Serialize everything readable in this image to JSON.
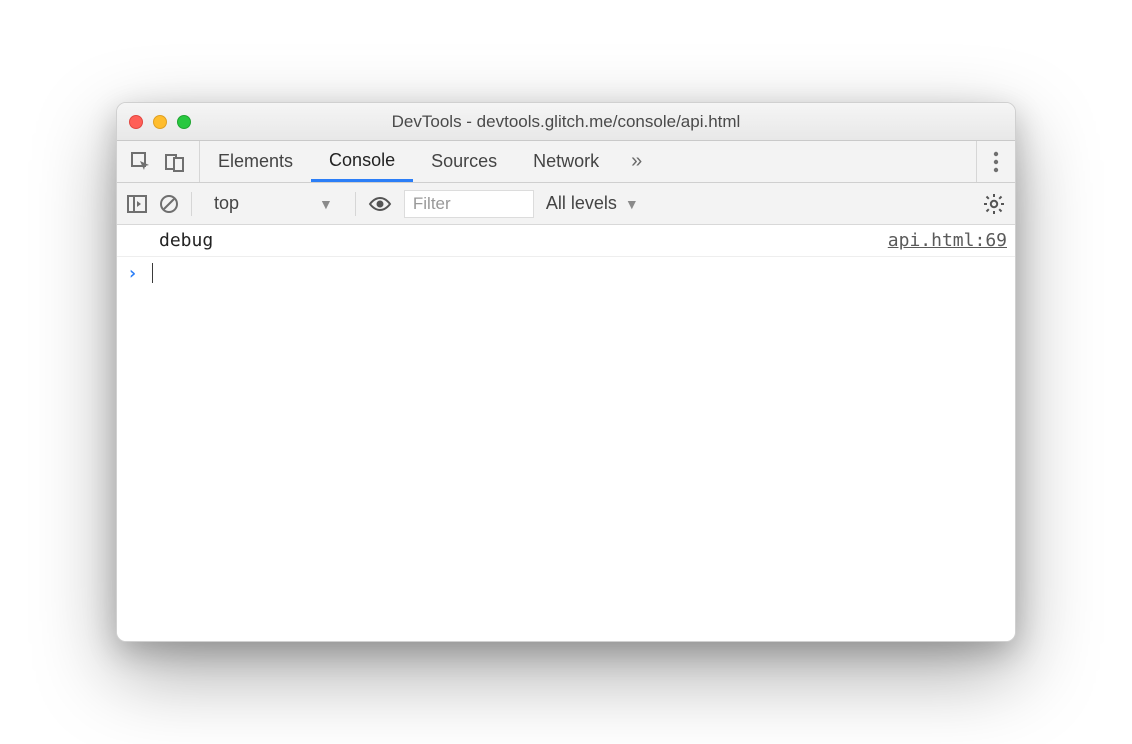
{
  "window": {
    "title": "DevTools - devtools.glitch.me/console/api.html"
  },
  "tabs": {
    "items": [
      "Elements",
      "Console",
      "Sources",
      "Network"
    ],
    "active_index": 1,
    "overflow_glyph": "»"
  },
  "toolbar": {
    "context": "top",
    "filter_placeholder": "Filter",
    "levels_label": "All levels"
  },
  "console": {
    "entries": [
      {
        "message": "debug",
        "source": "api.html:69"
      }
    ],
    "prompt_glyph": "›"
  }
}
